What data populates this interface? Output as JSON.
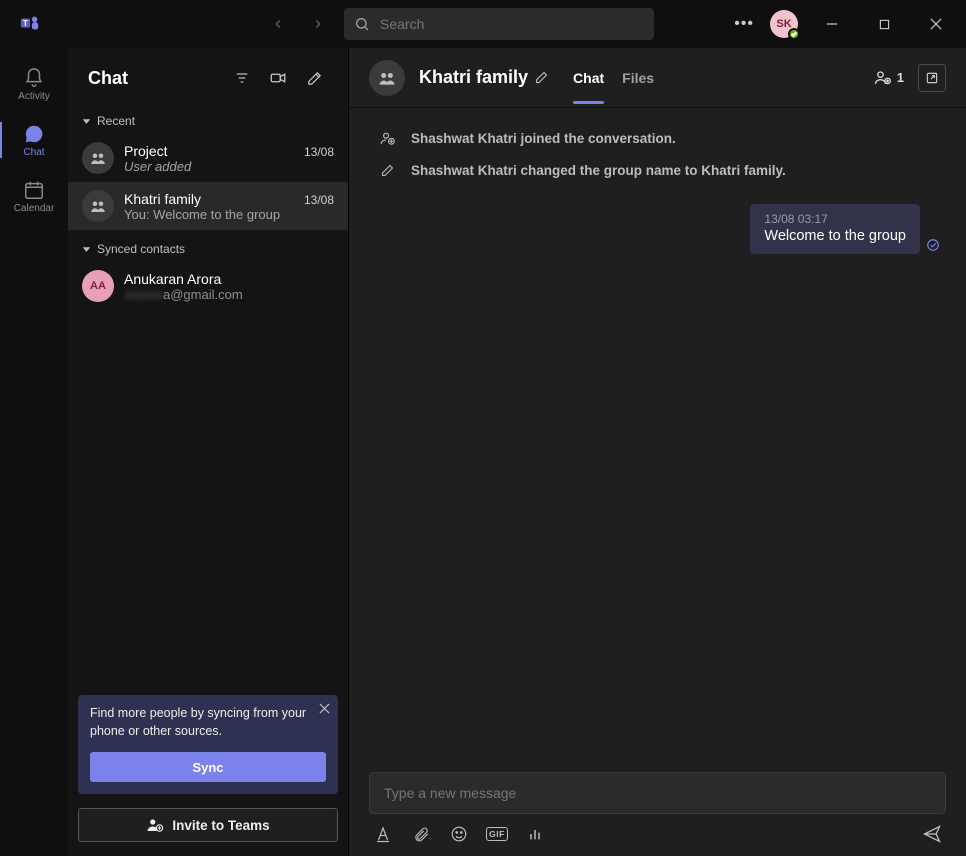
{
  "title_bar": {
    "search_placeholder": "Search",
    "avatar_initials": "SK"
  },
  "rail": {
    "items": [
      {
        "label": "Activity",
        "icon": "bell"
      },
      {
        "label": "Chat",
        "icon": "chat"
      },
      {
        "label": "Calendar",
        "icon": "calendar"
      }
    ]
  },
  "chat_list": {
    "title": "Chat",
    "sections": {
      "recent": "Recent",
      "synced": "Synced contacts"
    },
    "conversations": [
      {
        "name": "Project",
        "preview": "User added",
        "date": "13/08",
        "selected": false,
        "italic": true
      },
      {
        "name": "Khatri family",
        "preview": "You: Welcome to the group",
        "date": "13/08",
        "selected": true,
        "italic": false
      }
    ],
    "contacts": [
      {
        "name": "Anukaran Arora",
        "email": "a@gmail.com",
        "initials": "AA"
      }
    ],
    "sync_card": {
      "text": "Find more people by syncing from your phone or other sources.",
      "button": "Sync"
    },
    "invite_label": "Invite to Teams"
  },
  "conversation": {
    "title": "Khatri family",
    "tabs": [
      {
        "label": "Chat",
        "active": true
      },
      {
        "label": "Files",
        "active": false
      }
    ],
    "participant_count": "1",
    "system_messages": [
      "Shashwat Khatri joined the conversation.",
      "Shashwat Khatri changed the group name to Khatri family."
    ],
    "messages": [
      {
        "timestamp": "13/08 03:17",
        "text": "Welcome to the group",
        "mine": true
      }
    ],
    "compose_placeholder": "Type a new message"
  }
}
